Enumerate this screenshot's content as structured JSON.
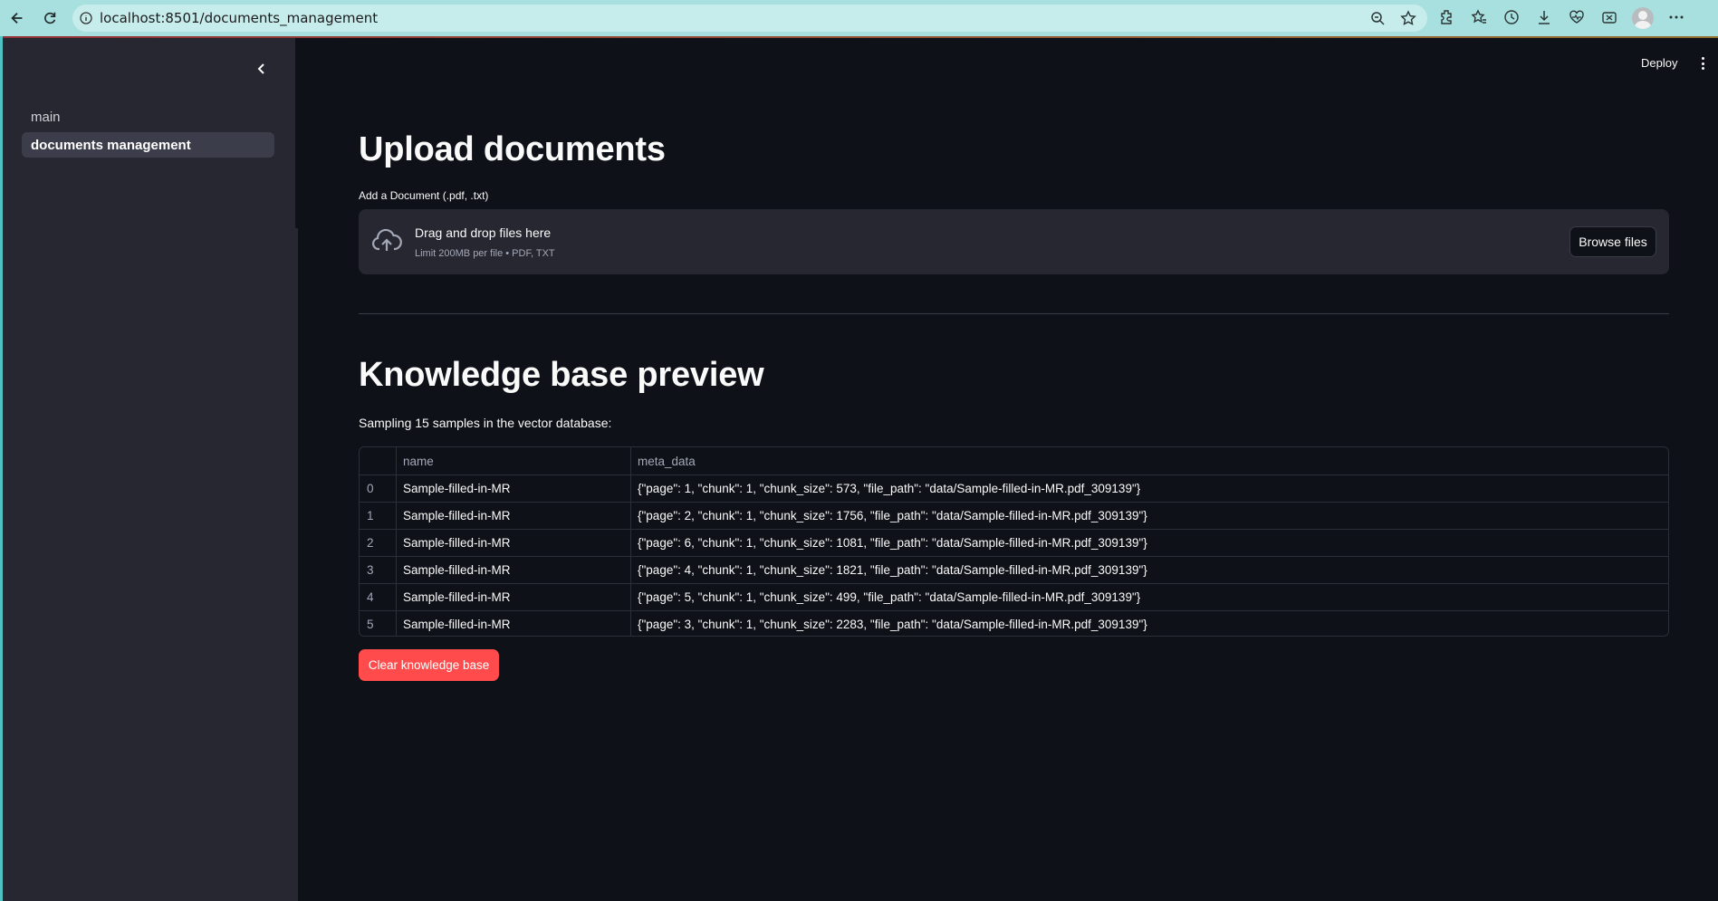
{
  "browser": {
    "url": "localhost:8501/documents_management"
  },
  "sidebar": {
    "items": [
      {
        "label": "main"
      },
      {
        "label": "documents management"
      }
    ]
  },
  "header": {
    "deploy_label": "Deploy"
  },
  "upload": {
    "title": "Upload documents",
    "field_label": "Add a Document (.pdf, .txt)",
    "drop_title": "Drag and drop files here",
    "drop_subtitle": "Limit 200MB per file • PDF, TXT",
    "browse_label": "Browse files"
  },
  "knowledge": {
    "title": "Knowledge base preview",
    "caption": "Sampling 15 samples in the vector database:",
    "columns": [
      "",
      "name",
      "meta_data"
    ],
    "rows": [
      {
        "index": "0",
        "name": "Sample-filled-in-MR",
        "meta": "{\"page\": 1, \"chunk\": 1, \"chunk_size\": 573, \"file_path\": \"data/Sample-filled-in-MR.pdf_309139\"}"
      },
      {
        "index": "1",
        "name": "Sample-filled-in-MR",
        "meta": "{\"page\": 2, \"chunk\": 1, \"chunk_size\": 1756, \"file_path\": \"data/Sample-filled-in-MR.pdf_309139\"}"
      },
      {
        "index": "2",
        "name": "Sample-filled-in-MR",
        "meta": "{\"page\": 6, \"chunk\": 1, \"chunk_size\": 1081, \"file_path\": \"data/Sample-filled-in-MR.pdf_309139\"}"
      },
      {
        "index": "3",
        "name": "Sample-filled-in-MR",
        "meta": "{\"page\": 4, \"chunk\": 1, \"chunk_size\": 1821, \"file_path\": \"data/Sample-filled-in-MR.pdf_309139\"}"
      },
      {
        "index": "4",
        "name": "Sample-filled-in-MR",
        "meta": "{\"page\": 5, \"chunk\": 1, \"chunk_size\": 499, \"file_path\": \"data/Sample-filled-in-MR.pdf_309139\"}"
      },
      {
        "index": "5",
        "name": "Sample-filled-in-MR",
        "meta": "{\"page\": 3, \"chunk\": 1, \"chunk_size\": 2283, \"file_path\": \"data/Sample-filled-in-MR.pdf_309139\"}"
      }
    ],
    "clear_label": "Clear knowledge base"
  },
  "colors": {
    "background": "#0e1117",
    "sidebar": "#262730",
    "accent": "#ff4b4b",
    "browser_bar": "#a8e0e0"
  }
}
